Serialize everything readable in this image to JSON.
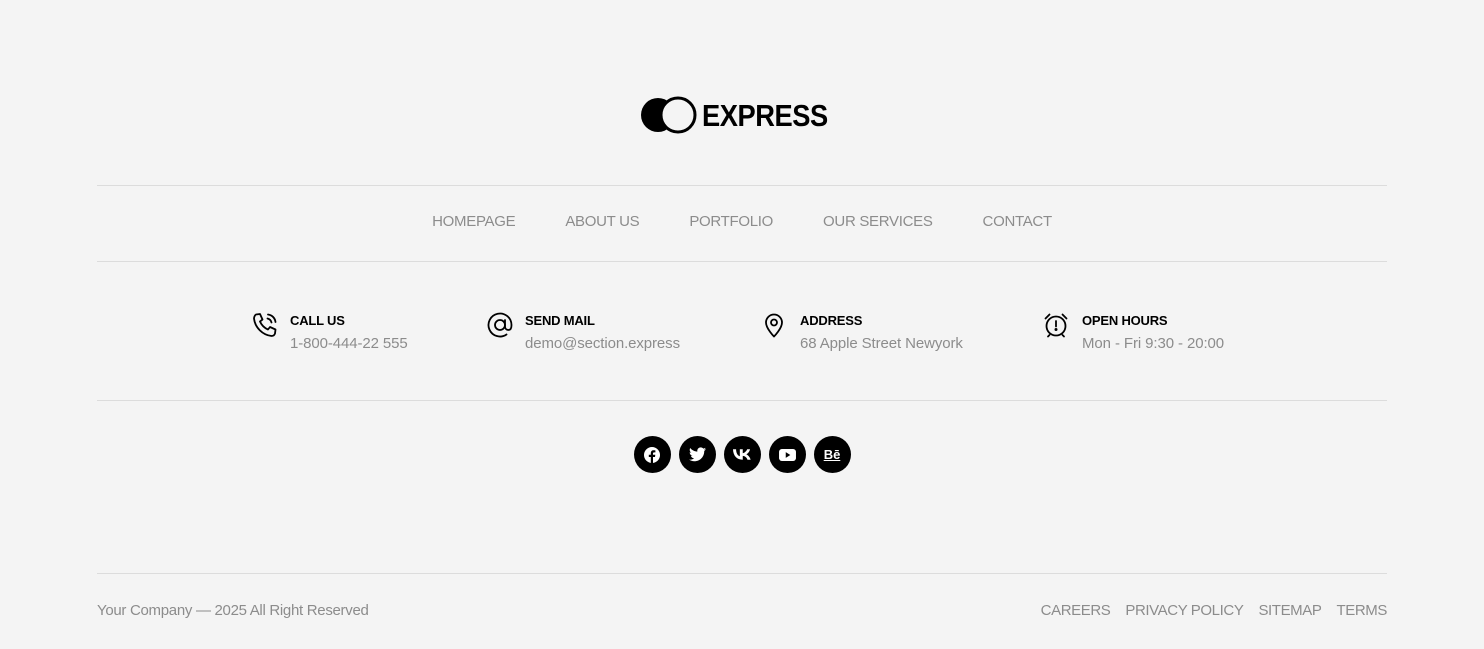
{
  "brand": {
    "name": "EXPRESS",
    "logo_icon": "twin-circles-logo"
  },
  "nav": {
    "items": [
      {
        "label": "HOMEPAGE"
      },
      {
        "label": "ABOUT US"
      },
      {
        "label": "PORTFOLIO"
      },
      {
        "label": "OUR SERVICES"
      },
      {
        "label": "CONTACT"
      }
    ]
  },
  "contacts": [
    {
      "icon": "phone-icon",
      "title": "CALL US",
      "value": "1-800-444-22 555"
    },
    {
      "icon": "at-sign-icon",
      "title": "SEND MAIL",
      "value": "demo@section.express"
    },
    {
      "icon": "map-pin-icon",
      "title": "ADDRESS",
      "value": "68 Apple Street Newyork"
    },
    {
      "icon": "alarm-clock-icon",
      "title": "OPEN HOURS",
      "value": "Mon - Fri 9:30 - 20:00"
    }
  ],
  "social": [
    {
      "icon": "facebook-icon"
    },
    {
      "icon": "twitter-icon"
    },
    {
      "icon": "vk-icon"
    },
    {
      "icon": "youtube-icon"
    },
    {
      "icon": "behance-icon",
      "label": "Bē"
    }
  ],
  "footer": {
    "copyright": "Your Company — 2025 All Right Reserved",
    "links": [
      {
        "label": "CAREERS"
      },
      {
        "label": "PRIVACY POLICY"
      },
      {
        "label": "SITEMAP"
      },
      {
        "label": "TERMS"
      }
    ]
  },
  "colors": {
    "background": "#f4f4f4",
    "text_muted": "#8c8c8c",
    "text_dark": "#000000",
    "divider": "#dcdcdc"
  }
}
